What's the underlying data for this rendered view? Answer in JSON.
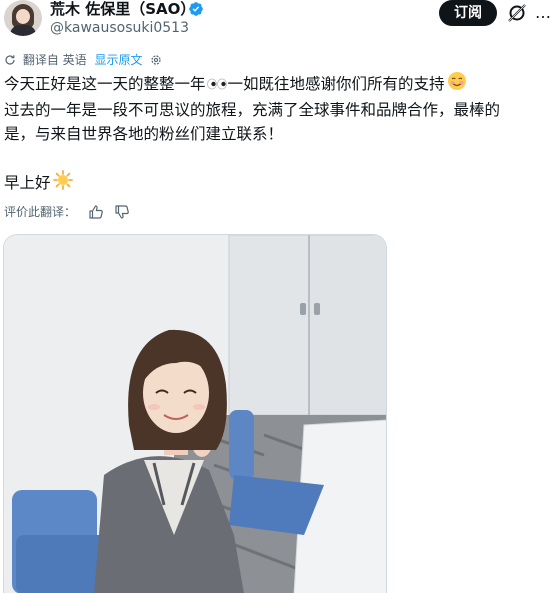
{
  "author": {
    "display_name": "荒木 佐保里（SAO）",
    "handle": "@kawausosuki0513",
    "verified": true
  },
  "actions": {
    "subscribe_label": "订阅"
  },
  "translation": {
    "note": "翻译自 英语",
    "show_original": "显示原文"
  },
  "tweet": {
    "line1": "今天正好是这一天的整整一年",
    "line1_cont": "一如既往地感谢你们所有的支持",
    "line2": "过去的一年是一段不可思议的旅程，充满了全球事件和品牌合作，最棒的",
    "line3": "是，与来自世界各地的粉丝们建立联系！",
    "line4": "早上好"
  },
  "rating": {
    "label": "评价此翻译："
  },
  "colors": {
    "text": "#0f1419",
    "secondary": "#536471",
    "link": "#1d9bf0",
    "button_bg": "#0f1419"
  },
  "icons": [
    "verified-badge-icon",
    "grok-icon",
    "more-icon",
    "translate-icon",
    "settings-icon",
    "thumbs-up-icon",
    "thumbs-down-icon",
    "eyes-emoji",
    "smiling-face-emoji",
    "sun-emoji"
  ]
}
